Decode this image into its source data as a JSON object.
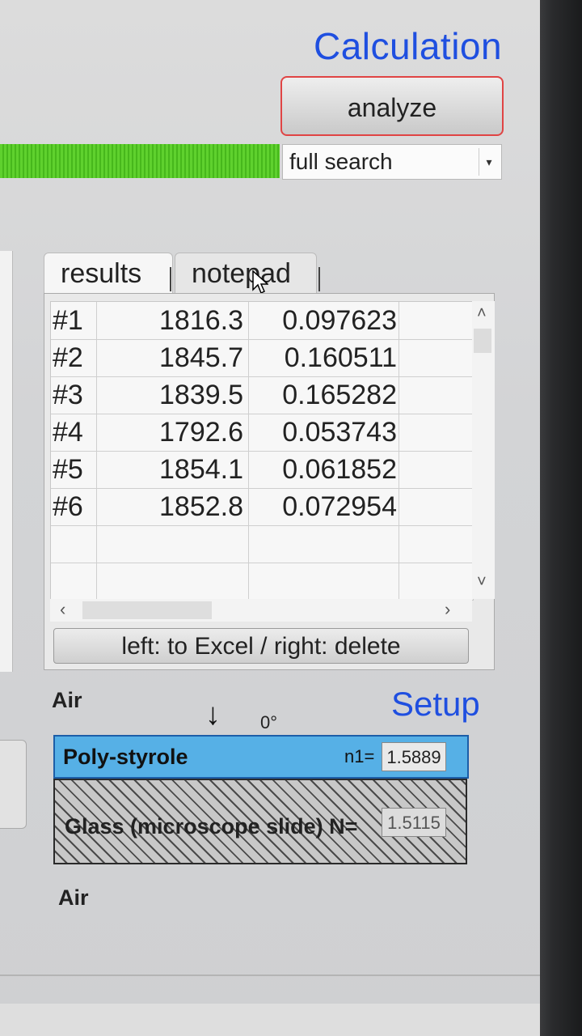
{
  "calculation": {
    "title": "Calculation",
    "analyze_label": "analyze",
    "progress": 1.0,
    "search_mode": "full search"
  },
  "tabs": [
    {
      "label": "results",
      "active": true
    },
    {
      "label": "notepad",
      "active": false
    }
  ],
  "results": {
    "rows": [
      {
        "id": "#1",
        "a": "1816.3",
        "b": "0.097623"
      },
      {
        "id": "#2",
        "a": "1845.7",
        "b": "0.160511"
      },
      {
        "id": "#3",
        "a": "1839.5",
        "b": "0.165282"
      },
      {
        "id": "#4",
        "a": "1792.6",
        "b": "0.053743"
      },
      {
        "id": "#5",
        "a": "1854.1",
        "b": "0.061852"
      },
      {
        "id": "#6",
        "a": "1852.8",
        "b": "0.072954"
      }
    ],
    "excel_button": "left: to Excel / right: delete"
  },
  "setup": {
    "title": "Setup",
    "air_top": "Air",
    "angle": "0°",
    "layer1": {
      "name": "Poly-styrole",
      "n_label": "n1=",
      "n_value": "1.5889"
    },
    "layer2": {
      "name": "Glass (microscope slide) N=",
      "n_value": "1.5115"
    },
    "air_bottom": "Air"
  },
  "colors": {
    "accent_title": "#1f4fe0",
    "progress_green": "#5fd12e",
    "layer1_blue": "#56b0e6",
    "button_border_red": "#e04444"
  }
}
